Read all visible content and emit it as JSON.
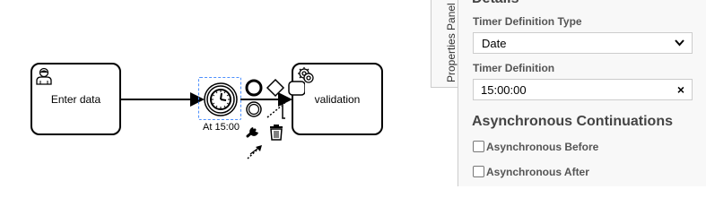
{
  "diagram": {
    "tasks": {
      "enter_data": {
        "label": "Enter data",
        "icon": "user-icon"
      },
      "validation": {
        "label": "validation",
        "icon": "gear-icon"
      }
    },
    "timer_event": {
      "label": "At 15:00",
      "icon": "clock-icon"
    },
    "context_pad": [
      "end-event-icon",
      "gateway-icon",
      "task-icon",
      "intermediate-event-icon",
      "text-annotation-icon",
      "wrench-icon",
      "trash-icon",
      "connect-arrow-icon"
    ]
  },
  "properties_panel": {
    "tab_label": "Properties Panel",
    "details_title": "Details",
    "timer_definition_type": {
      "label": "Timer Definition Type",
      "value": "Date"
    },
    "timer_definition": {
      "label": "Timer Definition",
      "value": "15:00:00",
      "clear_symbol": "×"
    },
    "async": {
      "title": "Asynchronous Continuations",
      "before_label": "Asynchronous Before",
      "after_label": "Asynchronous After"
    }
  },
  "colors": {
    "selection": "#4d90fe",
    "panel_bg": "#f8f8f8",
    "border": "#cccccc"
  }
}
